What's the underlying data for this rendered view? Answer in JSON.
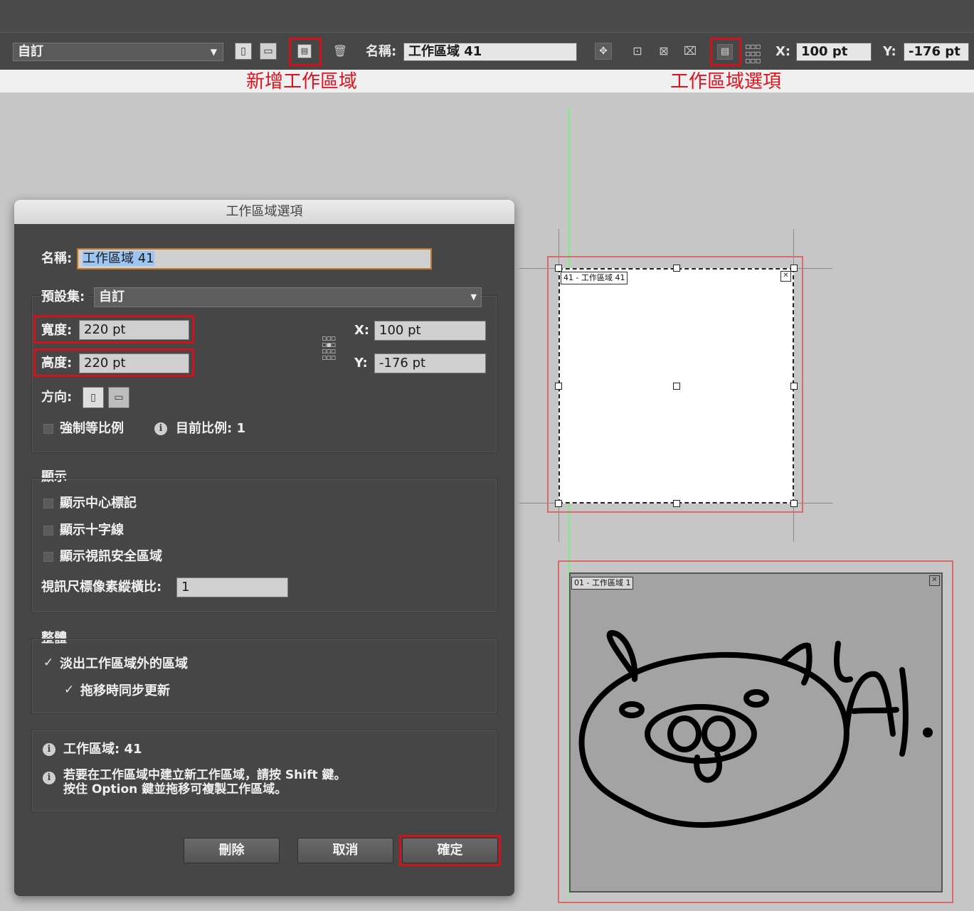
{
  "toolbar": {
    "preset_value": "自訂",
    "name_label": "名稱:",
    "name_value": "工作區域 41",
    "x_label": "X:",
    "x_value": "100 pt",
    "y_label": "Y:",
    "y_value": "-176 pt"
  },
  "annotations": {
    "new_artboard": "新增工作區域",
    "artboard_options": "工作區域選項"
  },
  "dialog": {
    "title": "工作區域選項",
    "name_label": "名稱:",
    "name_value": "工作區域 41",
    "preset_label": "預設集:",
    "preset_value": "自訂",
    "width_label": "寬度:",
    "width_value": "220 pt",
    "height_label": "高度:",
    "height_value": "220 pt",
    "x_label": "X:",
    "x_value": "100 pt",
    "y_label": "Y:",
    "y_value": "-176 pt",
    "orientation_label": "方向:",
    "constrain_label": "強制等比例",
    "ratio_label": "目前比例: 1",
    "display_section": "顯示",
    "show_center_mark": "顯示中心標記",
    "show_cross_hairs": "顯示十字線",
    "show_video_safe": "顯示視訊安全區域",
    "video_ruler_label": "視訊尺標像素縱橫比:",
    "video_ruler_value": "1",
    "global_section": "整體",
    "fade_outside_label": "淡出工作區域外的區域",
    "update_while_dragging_label": "拖移時同步更新",
    "artboards_info": "工作區域: 41",
    "tip_line1": "若要在工作區域中建立新工作區域，請按 Shift 鍵。",
    "tip_line2": "按住 Option 鍵並拖移可複製工作區域。",
    "delete_button": "刪除",
    "cancel_button": "取消",
    "ok_button": "確定"
  },
  "canvas": {
    "artboard_41_label": "41 - 工作區域 41",
    "artboard_1_label": "01 - 工作區域 1",
    "drawing_text": "YA!"
  }
}
